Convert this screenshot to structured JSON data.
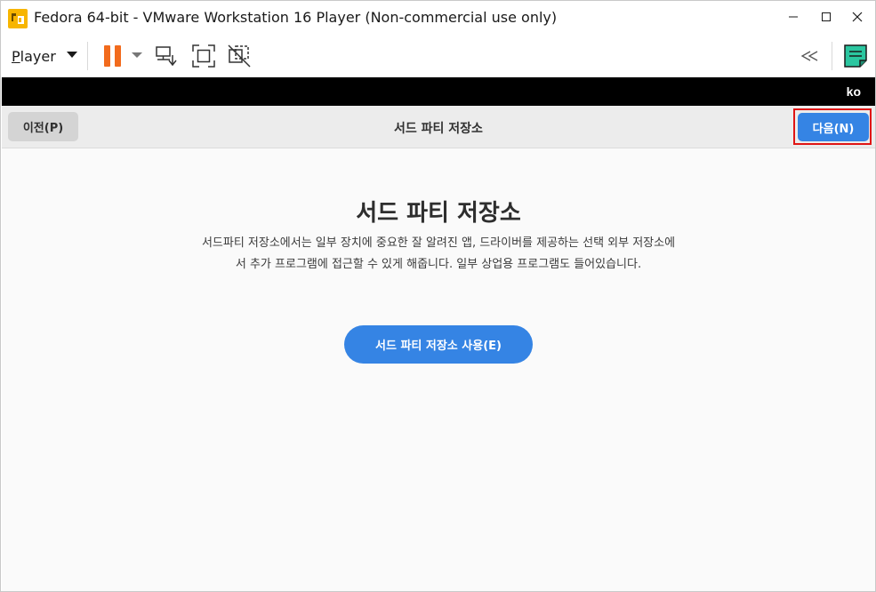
{
  "window": {
    "title": "Fedora 64-bit - VMware Workstation 16 Player (Non-commercial use only)",
    "app_icon": "vmware-player-logo-icon",
    "controls": [
      "minimize-icon",
      "maximize-icon",
      "close-icon"
    ]
  },
  "toolbar": {
    "player_menu_prefix": "P",
    "player_menu_rest": "layer",
    "icons": [
      "chevron-down-icon",
      "pause-icon",
      "chevron-down-icon",
      "send-ctrl-alt-del-icon",
      "fullscreen-icon",
      "unity-disabled-icon",
      "collapse-double-chevron-icon",
      "notes-icon"
    ],
    "accent_color": "#f26b1d"
  },
  "vm_header": {
    "language": "ko"
  },
  "nav": {
    "prev_label": "이전(P)",
    "title": "서드 파티 저장소",
    "next_label": "다음(N)",
    "next_color": "#3584e4"
  },
  "content": {
    "title": "서드 파티 저장소",
    "description_line1": "서드파티 저장소에서는 일부 장치에 중요한 잘 알려진 앱, 드라이버를 제공하는 선택 외부 저장소에",
    "description_line2": "서 추가 프로그램에 접근할 수 있게 해줍니다. 일부 상업용 프로그램도 들어있습니다.",
    "enable_button_label": "서드 파티 저장소 사용(E)"
  }
}
